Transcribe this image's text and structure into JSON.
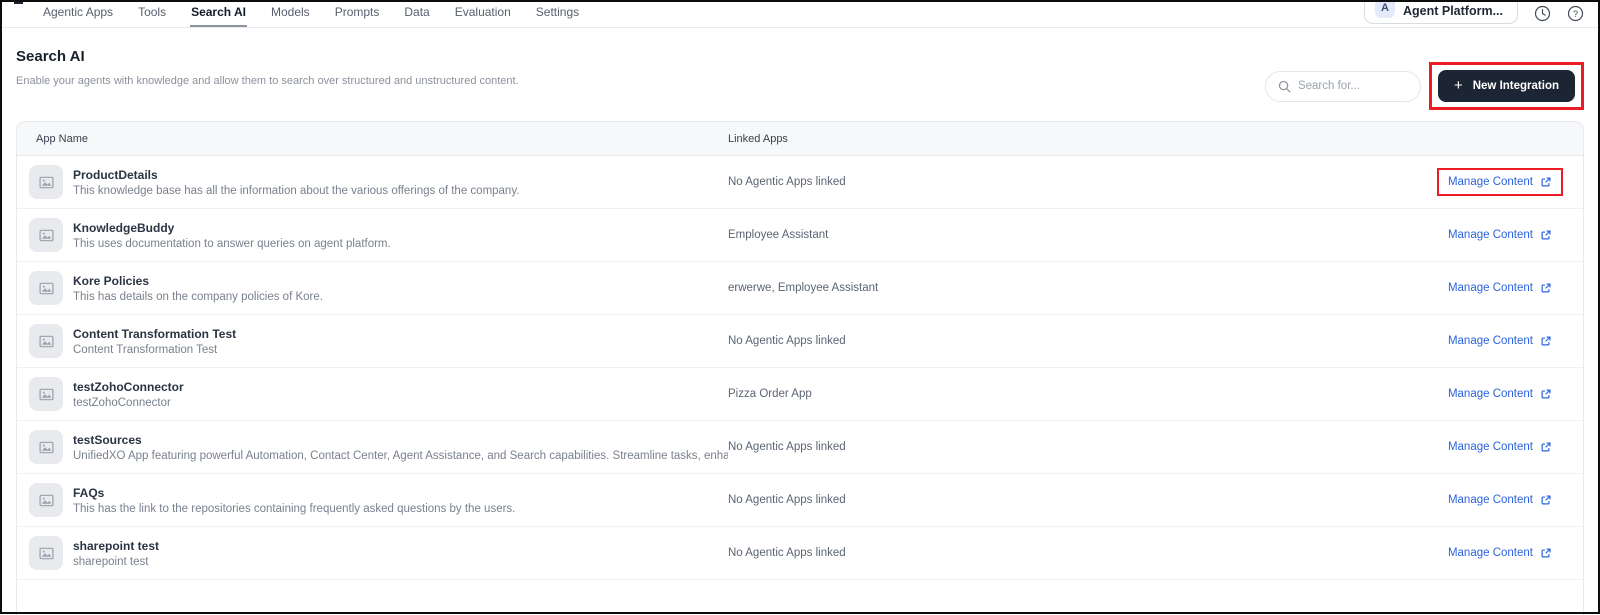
{
  "nav": {
    "tabs": [
      {
        "label": "Agentic Apps",
        "active": false
      },
      {
        "label": "Tools",
        "active": false
      },
      {
        "label": "Search AI",
        "active": true
      },
      {
        "label": "Models",
        "active": false
      },
      {
        "label": "Prompts",
        "active": false
      },
      {
        "label": "Data",
        "active": false
      },
      {
        "label": "Evaluation",
        "active": false
      },
      {
        "label": "Settings",
        "active": false
      }
    ],
    "account": {
      "avatar_initial": "A",
      "label": "Agent Platform..."
    },
    "icons": [
      "history-clock-icon",
      "help-icon"
    ]
  },
  "header": {
    "title": "Search AI",
    "subtitle": "Enable your agents with knowledge and allow them to search over structured and unstructured content.",
    "search_placeholder": "Search for...",
    "new_integration_label": "New Integration"
  },
  "table": {
    "columns": {
      "app_name": "App Name",
      "linked_apps": "Linked Apps"
    },
    "manage_content_label": "Manage Content",
    "rows": [
      {
        "name": "ProductDetails",
        "description": "This knowledge base has all the information about the various offerings of the company.",
        "linked": "No Agentic Apps linked",
        "annotated": true
      },
      {
        "name": "KnowledgeBuddy",
        "description": "This uses documentation to answer queries on agent platform.",
        "linked": "Employee Assistant",
        "annotated": false
      },
      {
        "name": "Kore Policies",
        "description": "This has details on the company policies of Kore.",
        "linked": "erwerwe, Employee Assistant",
        "annotated": false
      },
      {
        "name": "Content Transformation Test",
        "description": "Content Transformation Test",
        "linked": "No Agentic Apps linked",
        "annotated": false
      },
      {
        "name": "testZohoConnector",
        "description": "testZohoConnector",
        "linked": "Pizza Order App",
        "annotated": false
      },
      {
        "name": "testSources",
        "description": "UnifiedXO App featuring powerful Automation, Contact Center, Agent Assistance, and Search capabilities. Streamline tasks, enha...",
        "linked": "No Agentic Apps linked",
        "annotated": false
      },
      {
        "name": "FAQs",
        "description": "This has the link to the repositories containing frequently asked questions by the users.",
        "linked": "No Agentic Apps linked",
        "annotated": false
      },
      {
        "name": "sharepoint test",
        "description": "sharepoint test",
        "linked": "No Agentic Apps linked",
        "annotated": false
      }
    ]
  },
  "colors": {
    "accent_blue": "#2c63dd",
    "button_dark": "#1c2533",
    "annotation_red": "#ec1b24",
    "header_bg": "#f7f8fa"
  }
}
